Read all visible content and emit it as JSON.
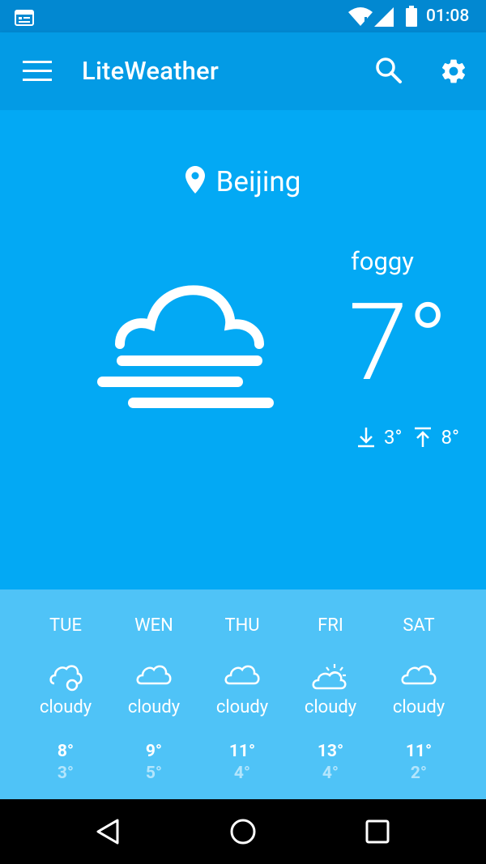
{
  "status_bar": {
    "time": "01:08"
  },
  "app_bar": {
    "title": "LiteWeather"
  },
  "current": {
    "location": "Beijing",
    "condition": "foggy",
    "temperature": "7°",
    "low": "3°",
    "high": "8°"
  },
  "forecast": [
    {
      "day": "TUE",
      "desc": "cloudy",
      "high": "8°",
      "low": "3°",
      "icon": "cloud-icon"
    },
    {
      "day": "WEN",
      "desc": "cloudy",
      "high": "9°",
      "low": "5°",
      "icon": "cloud-icon"
    },
    {
      "day": "THU",
      "desc": "cloudy",
      "high": "11°",
      "low": "4°",
      "icon": "cloud-icon"
    },
    {
      "day": "FRI",
      "desc": "cloudy",
      "high": "13°",
      "low": "4°",
      "icon": "partly-sunny-icon"
    },
    {
      "day": "SAT",
      "desc": "cloudy",
      "high": "11°",
      "low": "2°",
      "icon": "cloud-icon"
    }
  ],
  "colors": {
    "status_bar": "#0288D1",
    "app_bar": "#039BE5",
    "main_bg": "#03A9F4",
    "forecast_bg": "#4FC3F7",
    "low_temp": "#B3E5FC"
  }
}
